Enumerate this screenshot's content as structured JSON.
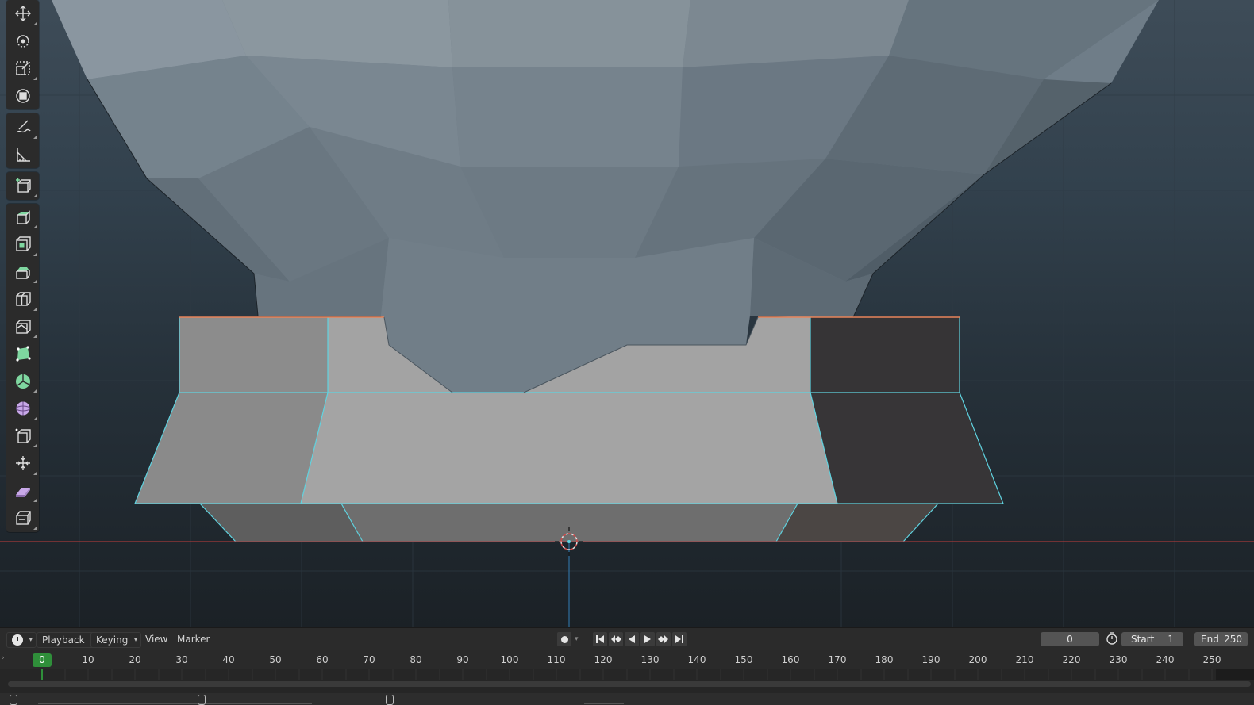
{
  "viewport": {
    "toolbar": [
      {
        "name": "move-icon"
      },
      {
        "name": "rotate-icon"
      },
      {
        "name": "scale-icon"
      },
      {
        "name": "transform-icon"
      },
      {
        "name": "annotate-icon"
      },
      {
        "name": "measure-icon"
      },
      {
        "name": "add-cube-icon"
      },
      {
        "name": "extrude-region-icon"
      },
      {
        "name": "inset-faces-icon"
      },
      {
        "name": "bevel-icon"
      },
      {
        "name": "loop-cut-icon"
      },
      {
        "name": "knife-icon"
      },
      {
        "name": "poly-build-icon"
      },
      {
        "name": "spin-icon"
      },
      {
        "name": "smooth-icon"
      },
      {
        "name": "edge-slide-icon"
      },
      {
        "name": "shrink-fatten-icon"
      },
      {
        "name": "shear-icon"
      },
      {
        "name": "rip-region-icon"
      }
    ]
  },
  "timeline": {
    "editor_type_icon": "clock-icon",
    "menus": {
      "playback": "Playback",
      "keying": "Keying",
      "view": "View",
      "marker": "Marker"
    },
    "current_frame": "0",
    "start_label": "Start",
    "start_value": "1",
    "end_label": "End",
    "end_value": "250",
    "ruler_labels": [
      "10",
      "20",
      "30",
      "40",
      "50",
      "60",
      "70",
      "80",
      "90",
      "100",
      "110",
      "120",
      "130",
      "140",
      "150",
      "160",
      "170",
      "180",
      "190",
      "200",
      "210",
      "220",
      "230",
      "240",
      "250"
    ],
    "indicator_label": "0"
  },
  "colors": {
    "selection_edge": "#5fd3e0",
    "active_edge": "#e8845a",
    "frame_indicator": "#2f8f3a",
    "x_axis": "#a33a3a",
    "y_axis": "#2f6fa0"
  }
}
